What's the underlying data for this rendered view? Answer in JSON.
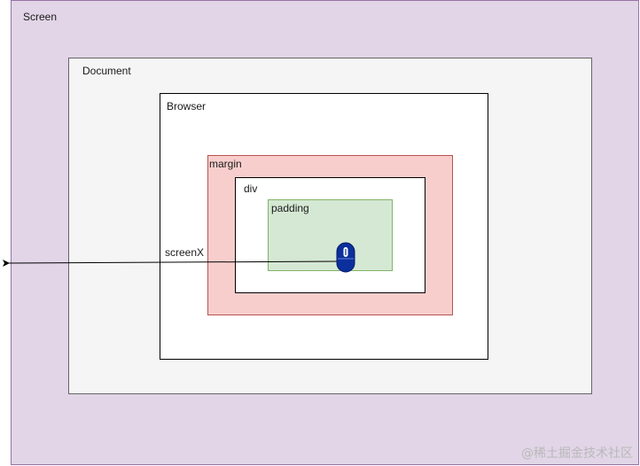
{
  "labels": {
    "screen": "Screen",
    "document": "Document",
    "browser": "Browser",
    "margin": "margin",
    "div": "div",
    "padding": "padding",
    "screen_x": "screenX"
  },
  "watermark": "@稀土掘金技术社区",
  "colors": {
    "screen_fill": "#e1d5e7",
    "screen_stroke": "#9673a6",
    "document_fill": "#f5f5f5",
    "margin_fill": "#f8cecc",
    "margin_stroke": "#b85450",
    "padding_fill": "#d5e8d4",
    "padding_stroke": "#82b366",
    "mouse": "#0b2f9c"
  },
  "icons": {
    "mouse": "mouse-icon"
  }
}
